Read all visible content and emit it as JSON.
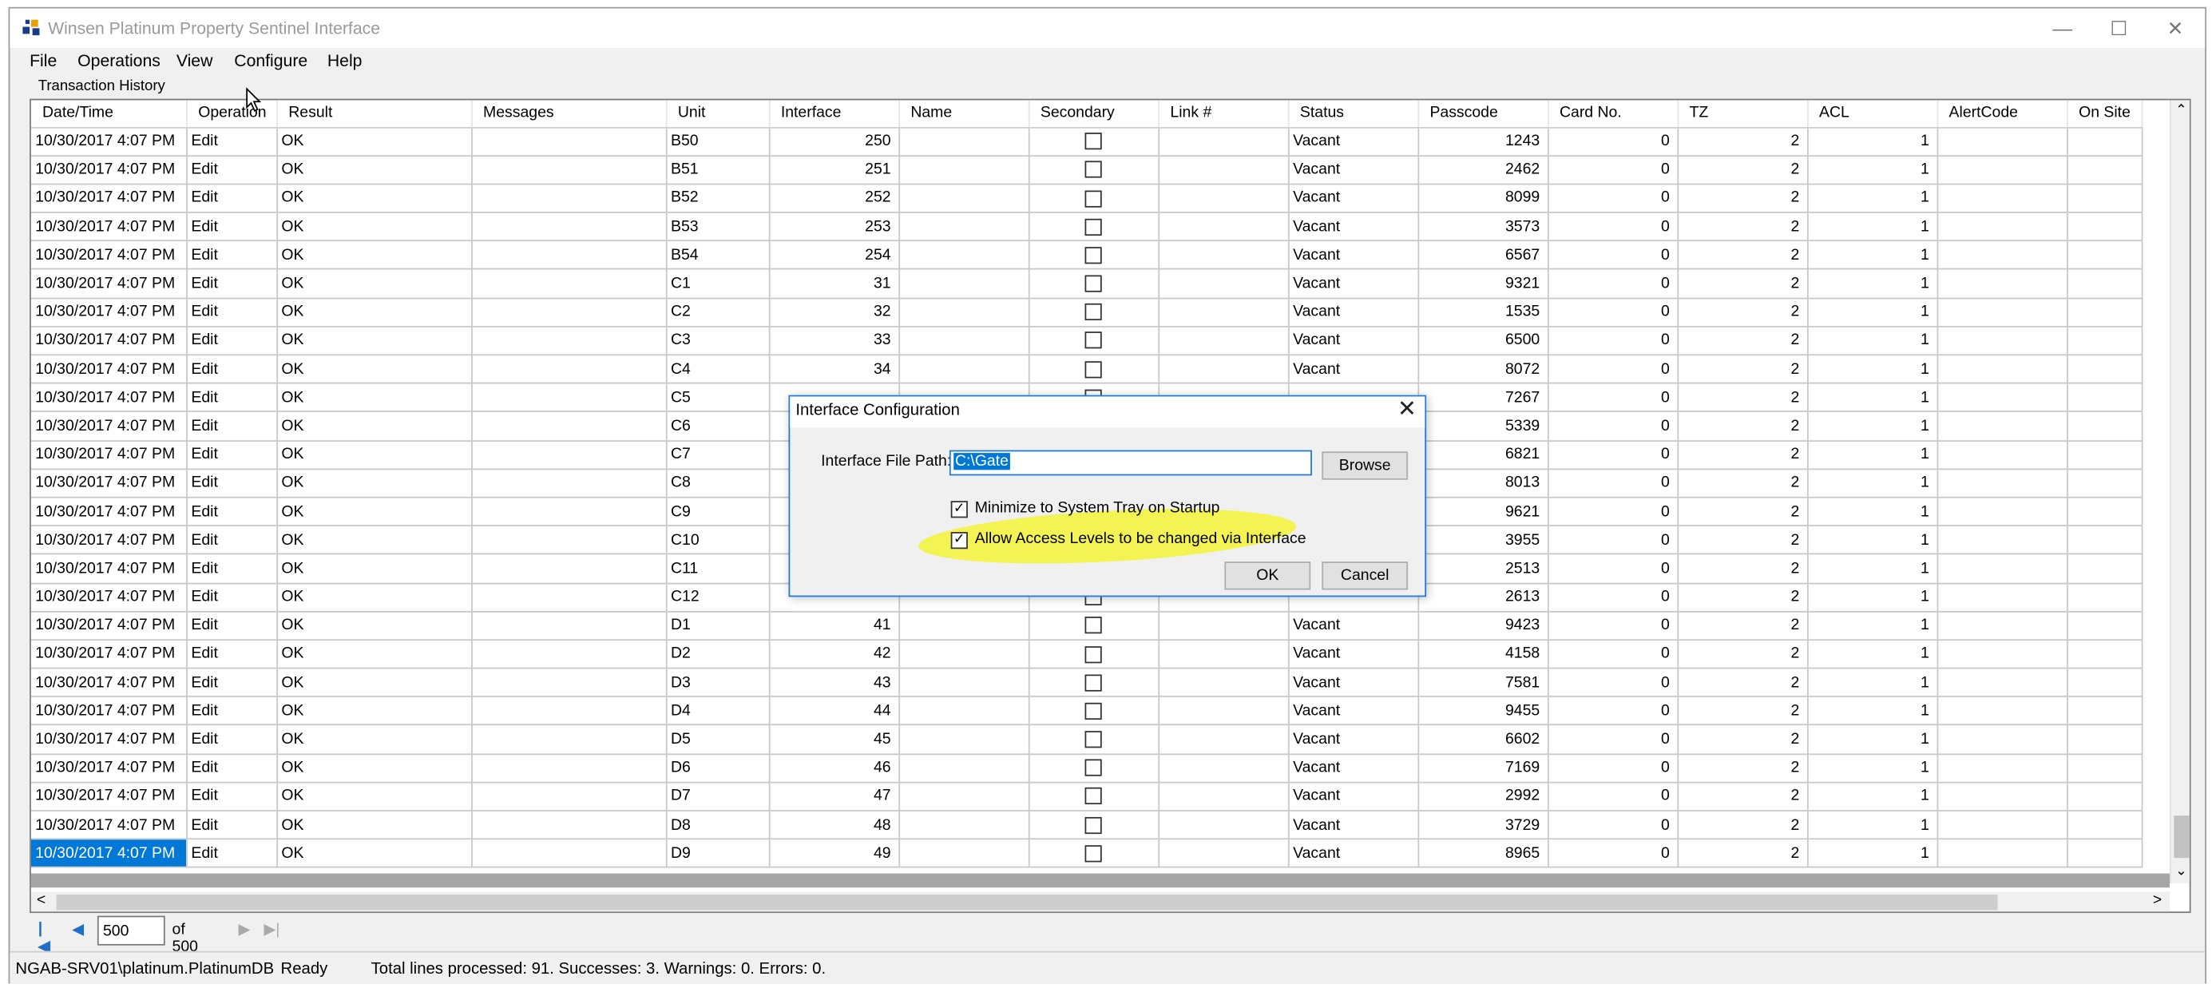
{
  "window": {
    "title": "Winsen Platinum Property Sentinel Interface",
    "minimize_glyph": "—",
    "maximize_glyph": "☐",
    "close_glyph": "✕"
  },
  "menu": [
    "File",
    "Operations",
    "View",
    "Configure",
    "Help"
  ],
  "tab_label": "Transaction History",
  "grid": {
    "columns": [
      "Date/Time",
      "Operation",
      "Result",
      "Messages",
      "Unit",
      "Interface",
      "Name",
      "Secondary",
      "Link #",
      "Status",
      "Passcode",
      "Card No.",
      "TZ",
      "ACL",
      "AlertCode",
      "On Site"
    ],
    "rows": [
      [
        "10/30/2017 4:07 PM",
        "Edit",
        "OK",
        "",
        "B50",
        "250",
        "",
        "",
        "",
        "Vacant",
        "1243",
        "0",
        "2",
        "1",
        "",
        ""
      ],
      [
        "10/30/2017 4:07 PM",
        "Edit",
        "OK",
        "",
        "B51",
        "251",
        "",
        "",
        "",
        "Vacant",
        "2462",
        "0",
        "2",
        "1",
        "",
        ""
      ],
      [
        "10/30/2017 4:07 PM",
        "Edit",
        "OK",
        "",
        "B52",
        "252",
        "",
        "",
        "",
        "Vacant",
        "8099",
        "0",
        "2",
        "1",
        "",
        ""
      ],
      [
        "10/30/2017 4:07 PM",
        "Edit",
        "OK",
        "",
        "B53",
        "253",
        "",
        "",
        "",
        "Vacant",
        "3573",
        "0",
        "2",
        "1",
        "",
        ""
      ],
      [
        "10/30/2017 4:07 PM",
        "Edit",
        "OK",
        "",
        "B54",
        "254",
        "",
        "",
        "",
        "Vacant",
        "6567",
        "0",
        "2",
        "1",
        "",
        ""
      ],
      [
        "10/30/2017 4:07 PM",
        "Edit",
        "OK",
        "",
        "C1",
        "31",
        "",
        "",
        "",
        "Vacant",
        "9321",
        "0",
        "2",
        "1",
        "",
        ""
      ],
      [
        "10/30/2017 4:07 PM",
        "Edit",
        "OK",
        "",
        "C2",
        "32",
        "",
        "",
        "",
        "Vacant",
        "1535",
        "0",
        "2",
        "1",
        "",
        ""
      ],
      [
        "10/30/2017 4:07 PM",
        "Edit",
        "OK",
        "",
        "C3",
        "33",
        "",
        "",
        "",
        "Vacant",
        "6500",
        "0",
        "2",
        "1",
        "",
        ""
      ],
      [
        "10/30/2017 4:07 PM",
        "Edit",
        "OK",
        "",
        "C4",
        "34",
        "",
        "",
        "",
        "Vacant",
        "8072",
        "0",
        "2",
        "1",
        "",
        ""
      ],
      [
        "10/30/2017 4:07 PM",
        "Edit",
        "OK",
        "",
        "C5",
        "",
        "",
        "",
        "",
        "",
        "7267",
        "0",
        "2",
        "1",
        "",
        ""
      ],
      [
        "10/30/2017 4:07 PM",
        "Edit",
        "OK",
        "",
        "C6",
        "",
        "",
        "",
        "",
        "",
        "5339",
        "0",
        "2",
        "1",
        "",
        ""
      ],
      [
        "10/30/2017 4:07 PM",
        "Edit",
        "OK",
        "",
        "C7",
        "",
        "",
        "",
        "",
        "",
        "6821",
        "0",
        "2",
        "1",
        "",
        ""
      ],
      [
        "10/30/2017 4:07 PM",
        "Edit",
        "OK",
        "",
        "C8",
        "",
        "",
        "",
        "",
        "",
        "8013",
        "0",
        "2",
        "1",
        "",
        ""
      ],
      [
        "10/30/2017 4:07 PM",
        "Edit",
        "OK",
        "",
        "C9",
        "",
        "",
        "",
        "",
        "",
        "9621",
        "0",
        "2",
        "1",
        "",
        ""
      ],
      [
        "10/30/2017 4:07 PM",
        "Edit",
        "OK",
        "",
        "C10",
        "",
        "",
        "",
        "",
        "",
        "3955",
        "0",
        "2",
        "1",
        "",
        ""
      ],
      [
        "10/30/2017 4:07 PM",
        "Edit",
        "OK",
        "",
        "C11",
        "",
        "",
        "",
        "",
        "",
        "2513",
        "0",
        "2",
        "1",
        "",
        ""
      ],
      [
        "10/30/2017 4:07 PM",
        "Edit",
        "OK",
        "",
        "C12",
        "",
        "",
        "",
        "",
        "",
        "2613",
        "0",
        "2",
        "1",
        "",
        ""
      ],
      [
        "10/30/2017 4:07 PM",
        "Edit",
        "OK",
        "",
        "D1",
        "41",
        "",
        "",
        "",
        "Vacant",
        "9423",
        "0",
        "2",
        "1",
        "",
        ""
      ],
      [
        "10/30/2017 4:07 PM",
        "Edit",
        "OK",
        "",
        "D2",
        "42",
        "",
        "",
        "",
        "Vacant",
        "4158",
        "0",
        "2",
        "1",
        "",
        ""
      ],
      [
        "10/30/2017 4:07 PM",
        "Edit",
        "OK",
        "",
        "D3",
        "43",
        "",
        "",
        "",
        "Vacant",
        "7581",
        "0",
        "2",
        "1",
        "",
        ""
      ],
      [
        "10/30/2017 4:07 PM",
        "Edit",
        "OK",
        "",
        "D4",
        "44",
        "",
        "",
        "",
        "Vacant",
        "9455",
        "0",
        "2",
        "1",
        "",
        ""
      ],
      [
        "10/30/2017 4:07 PM",
        "Edit",
        "OK",
        "",
        "D5",
        "45",
        "",
        "",
        "",
        "Vacant",
        "6602",
        "0",
        "2",
        "1",
        "",
        ""
      ],
      [
        "10/30/2017 4:07 PM",
        "Edit",
        "OK",
        "",
        "D6",
        "46",
        "",
        "",
        "",
        "Vacant",
        "7169",
        "0",
        "2",
        "1",
        "",
        ""
      ],
      [
        "10/30/2017 4:07 PM",
        "Edit",
        "OK",
        "",
        "D7",
        "47",
        "",
        "",
        "",
        "Vacant",
        "2992",
        "0",
        "2",
        "1",
        "",
        ""
      ],
      [
        "10/30/2017 4:07 PM",
        "Edit",
        "OK",
        "",
        "D8",
        "48",
        "",
        "",
        "",
        "Vacant",
        "3729",
        "0",
        "2",
        "1",
        "",
        ""
      ],
      [
        "10/30/2017 4:07 PM",
        "Edit",
        "OK",
        "",
        "D9",
        "49",
        "",
        "",
        "",
        "Vacant",
        "8965",
        "0",
        "2",
        "1",
        "",
        ""
      ]
    ],
    "selected_row": 25
  },
  "pager": {
    "current_page": "500",
    "of_label": "of 500",
    "first_glyph": "|◀",
    "prev_glyph": "◀",
    "next_glyph": "▶",
    "last_glyph": "▶|"
  },
  "status": {
    "database": "NGAB-SRV01\\platinum.PlatinumDB",
    "state": "Ready",
    "summary": "Total lines processed: 91. Successes: 3. Warnings: 0. Errors: 0."
  },
  "dialog": {
    "title": "Interface Configuration",
    "path_label": "Interface File Path:",
    "path_value": "C:\\Gate",
    "browse_label": "Browse",
    "minimize_label": "Minimize to System Tray on Startup",
    "minimize_checked": true,
    "access_label": "Allow Access Levels to be changed via Interface",
    "access_checked": true,
    "ok_label": "OK",
    "cancel_label": "Cancel",
    "close_glyph": "✕"
  },
  "colors": {
    "selection": "#0078d7",
    "highlight": "#f2f34a",
    "dialog_border": "#1e7ad8"
  },
  "scroll": {
    "up_glyph": "⌃",
    "down_glyph": "⌄",
    "left_glyph": "<",
    "right_glyph": ">"
  }
}
